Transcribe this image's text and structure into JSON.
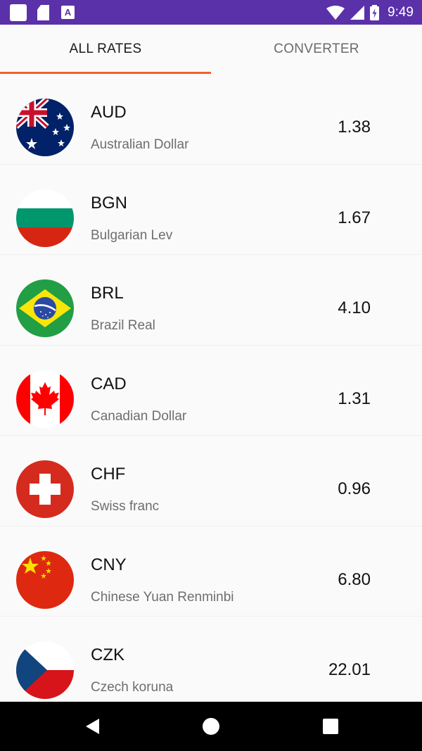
{
  "status_bar": {
    "time": "9:49",
    "notification_a": "A",
    "icons": [
      "app-icon",
      "sd-card-icon",
      "a-notification-icon",
      "wifi-icon",
      "signal-icon",
      "battery-charging-icon"
    ]
  },
  "tabs": [
    {
      "label": "ALL RATES",
      "active": true
    },
    {
      "label": "CONVERTER",
      "active": false
    }
  ],
  "colors": {
    "status_bar": "#5a31a8",
    "tab_indicator": "#f0622c",
    "background": "#fafafa"
  },
  "rates": [
    {
      "code": "AUD",
      "name": "Australian Dollar",
      "rate": "1.38",
      "flag": "australia-flag-icon"
    },
    {
      "code": "BGN",
      "name": "Bulgarian Lev",
      "rate": "1.67",
      "flag": "bulgaria-flag-icon"
    },
    {
      "code": "BRL",
      "name": "Brazil Real",
      "rate": "4.10",
      "flag": "brazil-flag-icon"
    },
    {
      "code": "CAD",
      "name": "Canadian Dollar",
      "rate": "1.31",
      "flag": "canada-flag-icon"
    },
    {
      "code": "CHF",
      "name": "Swiss franc",
      "rate": "0.96",
      "flag": "switzerland-flag-icon"
    },
    {
      "code": "CNY",
      "name": "Chinese Yuan Renminbi",
      "rate": "6.80",
      "flag": "china-flag-icon"
    },
    {
      "code": "CZK",
      "name": "Czech koruna",
      "rate": "22.01",
      "flag": "czech-flag-icon"
    }
  ],
  "nav_bar": {
    "icons": [
      "back-icon",
      "home-icon",
      "recents-icon"
    ]
  }
}
